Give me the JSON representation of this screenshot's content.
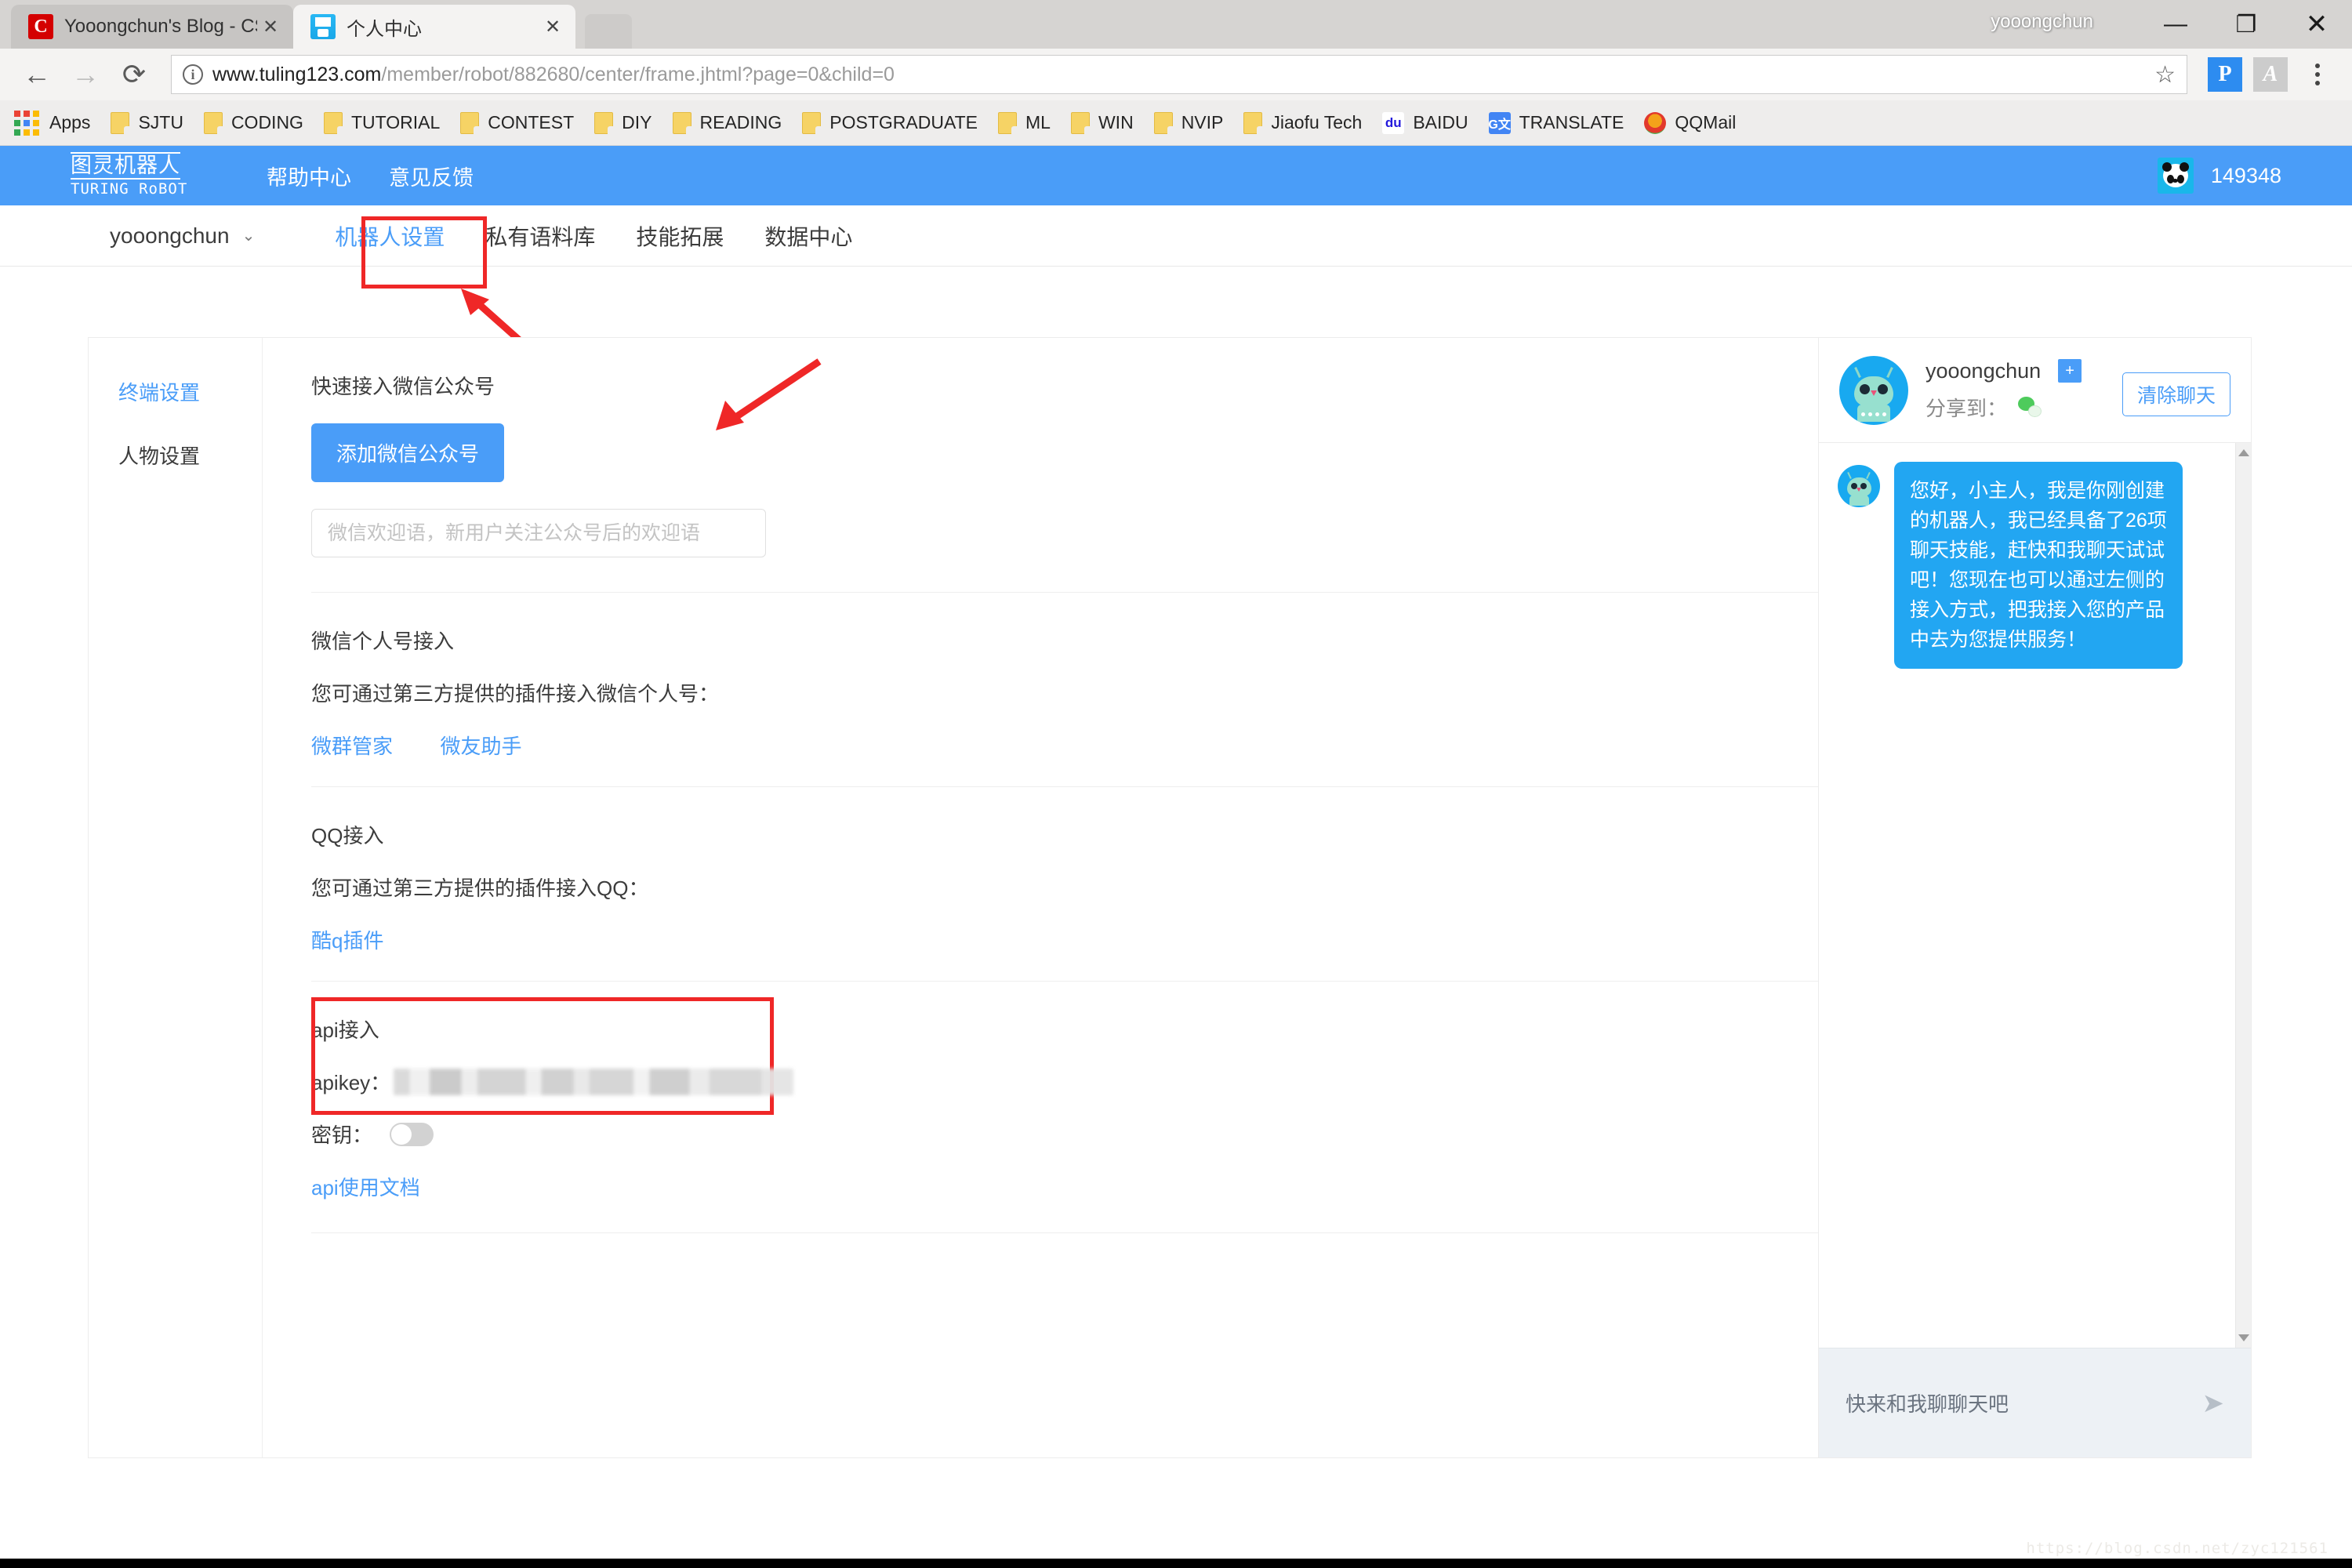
{
  "browser": {
    "tabs": [
      {
        "title": "Yooongchun's Blog - CSD",
        "favicon": "csdn-icon",
        "active": false
      },
      {
        "title": "个人中心",
        "favicon": "tuling-icon",
        "active": true
      }
    ],
    "window_title": "yooongchun",
    "window_controls": {
      "minimize": "—",
      "maximize": "❐",
      "close": "✕"
    },
    "nav": {
      "back": "←",
      "forward": "→",
      "reload": "⟳"
    },
    "url": {
      "host": "www.tuling123.com",
      "path": "/member/robot/882680/center/frame.jhtml?page=0&child=0"
    },
    "star_icon": "☆",
    "extensions": [
      {
        "name": "pocket-extension",
        "label": "P"
      },
      {
        "name": "pdf-extension",
        "label": "A"
      }
    ],
    "bookmarks": [
      {
        "label": "Apps",
        "icon": "apps-grid-icon"
      },
      {
        "label": "SJTU",
        "icon": "folder-icon"
      },
      {
        "label": "CODING",
        "icon": "folder-icon"
      },
      {
        "label": "TUTORIAL",
        "icon": "folder-icon"
      },
      {
        "label": "CONTEST",
        "icon": "folder-icon"
      },
      {
        "label": "DIY",
        "icon": "folder-icon"
      },
      {
        "label": "READING",
        "icon": "folder-icon"
      },
      {
        "label": "POSTGRADUATE",
        "icon": "folder-icon"
      },
      {
        "label": "ML",
        "icon": "folder-icon"
      },
      {
        "label": "WIN",
        "icon": "folder-icon"
      },
      {
        "label": "NVIP",
        "icon": "folder-icon"
      },
      {
        "label": "Jiaofu Tech",
        "icon": "folder-icon"
      },
      {
        "label": "BAIDU",
        "icon": "baidu-icon"
      },
      {
        "label": "TRANSLATE",
        "icon": "google-translate-icon"
      },
      {
        "label": "QQMail",
        "icon": "qqmail-icon"
      }
    ]
  },
  "site": {
    "logo_cn": "图灵机器人",
    "logo_en": "TURING RoBOT",
    "header_links": [
      "帮助中心",
      "意见反馈"
    ],
    "user_id": "149348",
    "avatar": "panda-avatar",
    "accent_color": "#4a9df8"
  },
  "subnav": {
    "username": "yooongchun",
    "chevron": "⌄",
    "tabs": [
      {
        "label": "机器人设置",
        "active": true
      },
      {
        "label": "私有语料库",
        "active": false
      },
      {
        "label": "技能拓展",
        "active": false
      },
      {
        "label": "数据中心",
        "active": false
      }
    ],
    "highlight_color": "#ef2727"
  },
  "sidebar": {
    "items": [
      {
        "label": "终端设置",
        "active": true
      },
      {
        "label": "人物设置",
        "active": false
      }
    ]
  },
  "main": {
    "wechat_mp": {
      "title": "快速接入微信公众号",
      "button": "添加微信公众号",
      "input_placeholder": "微信欢迎语，新用户关注公众号后的欢迎语",
      "input_value": ""
    },
    "wechat_personal": {
      "title": "微信个人号接入",
      "desc": "您可通过第三方提供的插件接入微信个人号：",
      "links": [
        "微群管家",
        "微友助手"
      ]
    },
    "qq": {
      "title": "QQ接入",
      "desc": "您可通过第三方提供的插件接入QQ：",
      "links": [
        "酷q插件"
      ]
    },
    "api": {
      "title": "api接入",
      "apikey_label": "apikey：",
      "apikey_value": "",
      "secret_label": "密钥：",
      "secret_toggle_on": false,
      "doc_link": "api使用文档"
    }
  },
  "chat": {
    "bot_name": "yooongchun",
    "copy_icon": "+",
    "share_label": "分享到：",
    "share_icon": "wechat-icon",
    "clear_button": "清除聊天",
    "messages": [
      {
        "from": "bot",
        "text": "您好，小主人，我是你刚创建的机器人，我已经具备了26项聊天技能，赶快和我聊天试试吧！您现在也可以通过左侧的接入方式，把我接入您的产品中去为您提供服务！"
      }
    ],
    "input_placeholder": "快来和我聊聊天吧",
    "send_icon": "send-icon",
    "scrollbar": {
      "up": "▲",
      "down": "▼"
    }
  },
  "watermark": "https://blog.csdn.net/zyc121561"
}
